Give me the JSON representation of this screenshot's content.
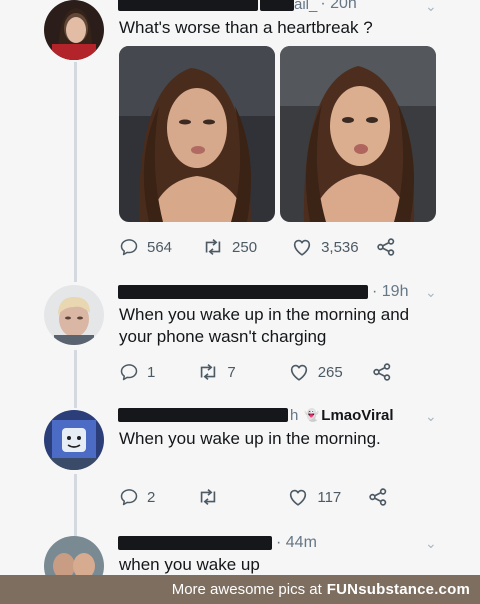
{
  "tweets": [
    {
      "handle_fragment": "ail_",
      "time": "· 20h",
      "text": "What's worse than a heartbreak ?",
      "replies": "564",
      "retweets": "250",
      "likes": "3,536"
    },
    {
      "time": "· 19h",
      "text_line1": "When you wake up in the morning and",
      "text_line2": "your phone wasn't charging",
      "replies": "1",
      "retweets": "7",
      "likes": "265"
    },
    {
      "handle_fragment": "h",
      "extra_handle": "LmaoViral",
      "text": "When you wake up in the morning.",
      "replies": "2",
      "retweets": "",
      "likes": "117"
    },
    {
      "time": "· 44m",
      "text": "when you wake up"
    }
  ],
  "footer": {
    "prefix": "More awesome pics at",
    "brand": "FUNsubstance.com"
  },
  "colors": {
    "text": "#14171a",
    "secondary": "#657786",
    "thread_line": "#d3d9de",
    "footer_bg": "#7d6e60"
  },
  "icons": [
    "reply-icon",
    "retweet-icon",
    "like-icon",
    "share-icon",
    "chevron-down-icon",
    "ghost-icon"
  ]
}
